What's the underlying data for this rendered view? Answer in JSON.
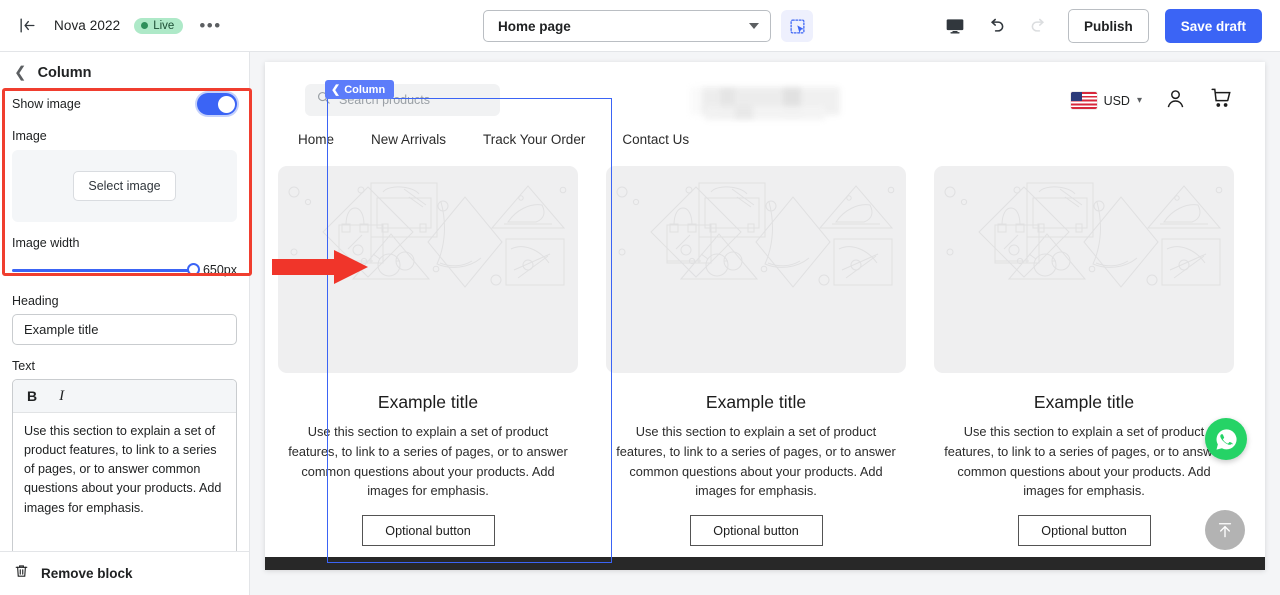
{
  "topbar": {
    "back_icon": "exit-icon",
    "store_name": "Nova 2022",
    "status_label": "Live",
    "more_label": "•••",
    "page_selector": {
      "value": "Home page"
    },
    "selector_tool_icon": "marquee-select-icon",
    "preview_icon": "desktop-preview-icon",
    "undo_icon": "undo-icon",
    "redo_icon": "redo-icon",
    "publish_label": "Publish",
    "save_draft_label": "Save draft"
  },
  "sidebar": {
    "back_icon": "chevron-left-icon",
    "title": "Column",
    "show_image_label": "Show image",
    "show_image_on": true,
    "image_label": "Image",
    "select_image_label": "Select image",
    "image_width_label": "Image width",
    "image_width_value": "650px",
    "heading_label": "Heading",
    "heading_value": "Example title",
    "text_label": "Text",
    "bold_label": "B",
    "italic_label": "I",
    "text_value": "Use this section to explain a set of product features, to link to a series of pages, or to answer common questions about your products. Add images for emphasis.",
    "remove_block_label": "Remove block",
    "remove_block_icon": "trash-icon"
  },
  "annotation": {
    "highlight_color": "#f03e2f",
    "arrow_icon": "right-arrow-annotation"
  },
  "preview": {
    "search": {
      "placeholder": "Search products",
      "icon": "search-icon"
    },
    "logo": "blurred-store-logo",
    "currency": {
      "flag": "us-flag-icon",
      "label": "USD",
      "caret": "chevron-down-icon"
    },
    "account_icon": "user-account-icon",
    "cart_icon": "shopping-cart-icon",
    "nav": [
      {
        "label": "Home"
      },
      {
        "label": "New Arrivals"
      },
      {
        "label": "Track Your Order"
      },
      {
        "label": "Contact Us"
      }
    ],
    "selection": {
      "tag_label": "Column",
      "tag_icon": "chevron-left-icon",
      "color": "#3b64f5"
    },
    "cards": [
      {
        "image": "product-placeholder-illustration",
        "title": "Example title",
        "text": "Use this section to explain a set of product features, to link to a series of pages, or to answer common questions about your products. Add images for emphasis.",
        "button": "Optional button"
      },
      {
        "image": "product-placeholder-illustration",
        "title": "Example title",
        "text": "Use this section to explain a set of product features, to link to a series of pages, or to answer common questions about your products. Add images for emphasis.",
        "button": "Optional button"
      },
      {
        "image": "product-placeholder-illustration",
        "title": "Example title",
        "text": "Use this section to explain a set of product features, to link to a series of pages, or to answer common questions about your products. Add images for emphasis.",
        "button": "Optional button"
      }
    ],
    "widgets": {
      "whatsapp_icon": "whatsapp-icon",
      "scroll_top_icon": "scroll-to-top-icon"
    }
  }
}
